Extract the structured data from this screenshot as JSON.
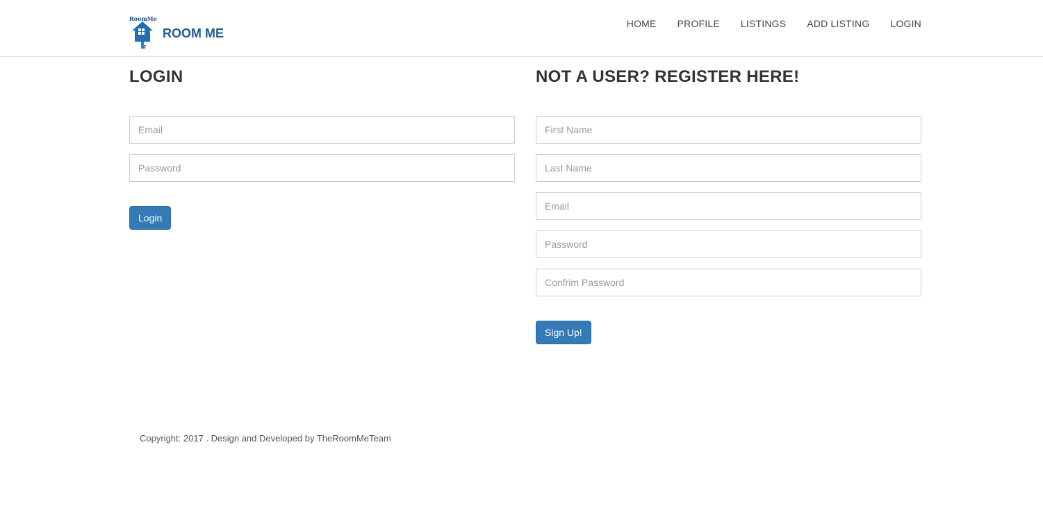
{
  "brand": {
    "logo_caption": "RoomMe",
    "name": "ROOM ME",
    "icon": "house-key-icon"
  },
  "nav": {
    "items": [
      "HOME",
      "PROFILE",
      "LISTINGS",
      "ADD LISTING",
      "LOGIN"
    ]
  },
  "login": {
    "title": "LOGIN",
    "email_placeholder": "Email",
    "password_placeholder": "Password",
    "button": "Login"
  },
  "register": {
    "title": "NOT A USER? REGISTER HERE!",
    "first_name_placeholder": "First Name",
    "last_name_placeholder": "Last Name",
    "email_placeholder": "Email",
    "password_placeholder": "Password",
    "confirm_placeholder": "Confrim Password",
    "button": "Sign Up!"
  },
  "footer": {
    "text": "Copyright: 2017 . Design and Developed by TheRoomMeTeam"
  },
  "colors": {
    "primary": "#337ab7",
    "brand": "#1e5a8f"
  }
}
